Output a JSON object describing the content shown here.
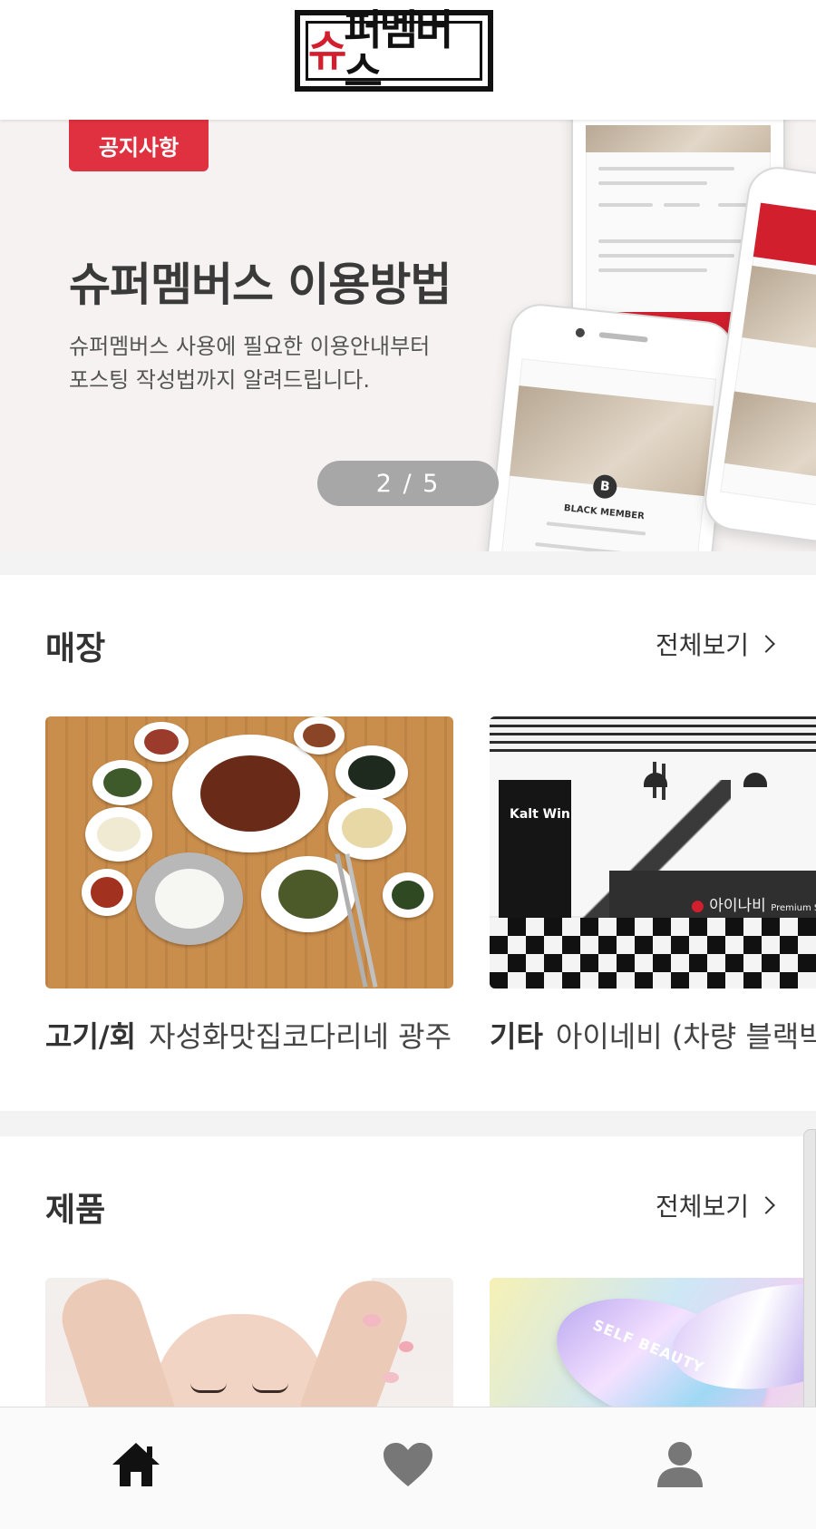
{
  "header": {
    "logo_text": "슈퍼멤버스",
    "logo_first": "슈",
    "logo_rest": "퍼멤버스"
  },
  "banner": {
    "tag": "공지사항",
    "title": "슈퍼멤버스 이용방법",
    "desc_line1": "슈퍼멤버스 사용에 필요한 이용안내부터",
    "desc_line2": "포스팅 작성법까지 알려드립니다.",
    "pager": "2 / 5",
    "mock_badge_letter": "B",
    "mock_member": "BLACK MEMBER"
  },
  "store_section": {
    "title": "매장",
    "more": "전체보기",
    "cards": [
      {
        "category": "고기/회",
        "name": "자성화맛집코다리네 광주"
      },
      {
        "category": "기타",
        "name": "아이네비 (차량 블랙박스"
      }
    ],
    "interior_sign": "Kalt Win",
    "interior_counter": "아이나비",
    "interior_counter_sub": "Premium St"
  },
  "product_section": {
    "title": "제품",
    "more": "전체보기",
    "product_text": "SELF BEAUTY"
  },
  "nav": {
    "items": [
      "home-icon",
      "heart-icon",
      "person-icon"
    ]
  },
  "colors": {
    "brand_red": "#d21f2e",
    "tag_red": "#e03140",
    "pager_gray": "#a7a7a7"
  }
}
